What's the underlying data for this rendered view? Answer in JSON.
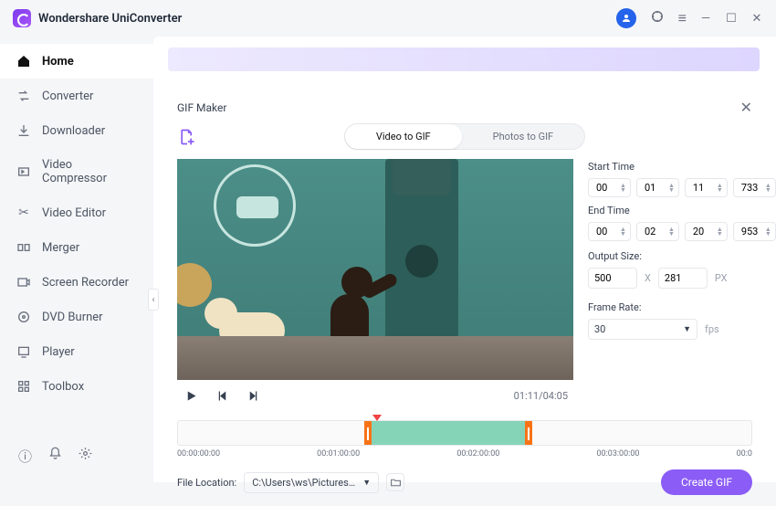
{
  "app": {
    "title": "Wondershare UniConverter"
  },
  "sidebar": {
    "items": [
      {
        "label": "Home"
      },
      {
        "label": "Converter"
      },
      {
        "label": "Downloader"
      },
      {
        "label": "Video Compressor"
      },
      {
        "label": "Video Editor"
      },
      {
        "label": "Merger"
      },
      {
        "label": "Screen Recorder"
      },
      {
        "label": "DVD Burner"
      },
      {
        "label": "Player"
      },
      {
        "label": "Toolbox"
      }
    ]
  },
  "modal": {
    "title": "GIF Maker",
    "tabs": {
      "video": "Video to GIF",
      "photos": "Photos to GIF"
    },
    "time_display": "01:11/04:05",
    "start_label": "Start Time",
    "end_label": "End Time",
    "start": {
      "h": "00",
      "m": "01",
      "s": "11",
      "ms": "733"
    },
    "end": {
      "h": "00",
      "m": "02",
      "s": "20",
      "ms": "953"
    },
    "output_label": "Output Size:",
    "out_w": "500",
    "out_h": "281",
    "px": "PX",
    "x": "X",
    "frame_label": "Frame Rate:",
    "frame_rate": "30",
    "fps": "fps",
    "file_loc_label": "File Location:",
    "file_loc_value": "C:\\Users\\ws\\Pictures\\Wonders",
    "create_btn": "Create GIF",
    "ticks": [
      "00:00:00:00",
      "00:01:00:00",
      "00:02:00:00",
      "00:03:00:00",
      "00:0"
    ]
  }
}
